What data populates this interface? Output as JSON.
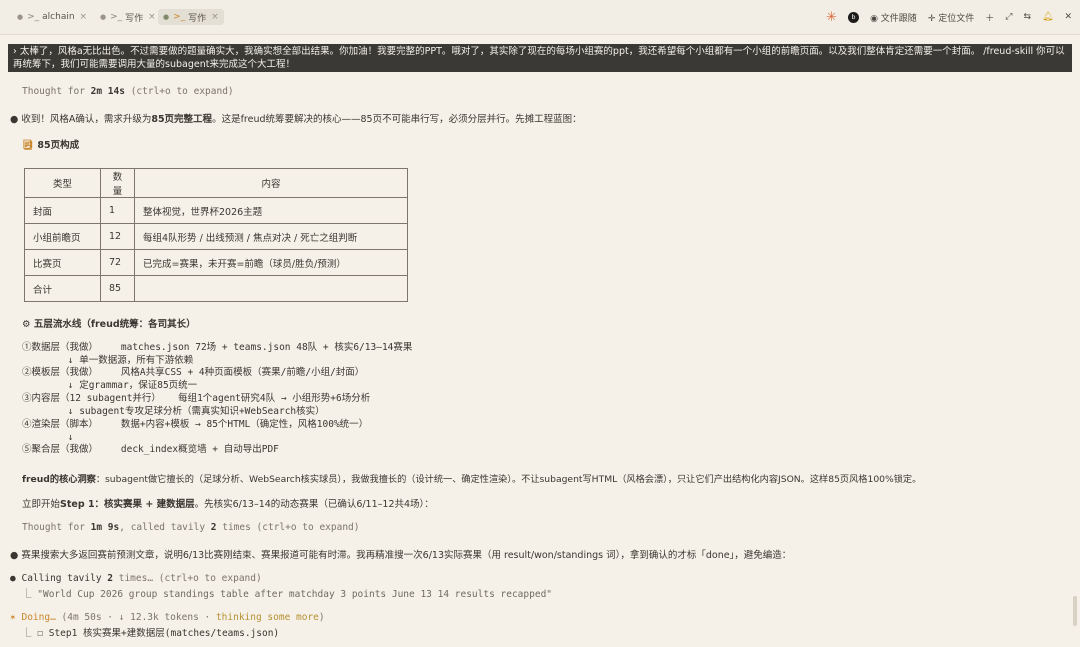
{
  "tabs": [
    {
      "label": "alchain",
      "active": false
    },
    {
      "label": "写作",
      "active": false
    },
    {
      "label": "写作",
      "active": true
    }
  ],
  "toolbar": {
    "file_follow": "文件跟随",
    "locate_file": "定位文件",
    "avatar_text": "b"
  },
  "prompt": {
    "text": "太棒了，风格a无比出色。不过需要做的题量确实大，我确实想全部出结果。你加油！我要完整的PPT。哦对了，其实除了现在的每场小组赛的ppt，我还希望每个小组都有一个小组的前瞻页面。以及我们整体肯定还需要一个封面。 /freud-skill 你可以再统筹下，我们可能需要调用大量的subagent来完成这个大工程！"
  },
  "thought1": {
    "prefix": "Thought for ",
    "time": "2m 14s",
    "suffix": " (ctrl+o to expand)"
  },
  "intro": {
    "a": "收到！风格A确认，需求升级为",
    "b": "85页完整工程",
    "c": "。这是freud统筹要解决的核心——85页不可能串行写，必须分层并行。先摊工程蓝图："
  },
  "section1_title": "85页构成",
  "table": {
    "headers": [
      "类型",
      "数量",
      "内容"
    ],
    "rows": [
      [
        "封面",
        "1",
        "整体视觉，世界杯2026主题"
      ],
      [
        "小组前瞻页",
        "12",
        "每组4队形势 / 出线预测 / 焦点对决 / 死亡之组判断"
      ],
      [
        "比赛页",
        "72",
        "已完成=赛果，未开赛=前瞻（球员/胜负/预测）"
      ],
      [
        "合计",
        "85",
        ""
      ]
    ]
  },
  "section2_title": "五层流水线（freud统筹：各司其长）",
  "pipeline": [
    "①数据层（我做）    matches.json 72场 + teams.json 48队 + 核实6/13–14赛果",
    "        ↓ 单一数据源，所有下游依赖",
    "②模板层（我做）    风格A共享CSS + 4种页面模板（赛果/前瞻/小组/封面）",
    "        ↓ 定grammar，保证85页统一",
    "③内容层（12 subagent并行）   每组1个agent研究4队 → 小组形势+6场分析",
    "        ↓ subagent专攻足球分析（需真实知识+WebSearch核实）",
    "④渲染层（脚本）    数据+内容+模板 → 85个HTML（确定性，风格100%统一）",
    "        ↓",
    "⑤聚合层（我做）    deck_index概览墙 + 自动导出PDF"
  ],
  "insight": {
    "label": "freud的核心洞察",
    "text": "：subagent做它擅长的（足球分析、WebSearch核实球员），我做我擅长的（设计统一、确定性渲染）。不让subagent写HTML（风格会漂），只让它们产出结构化内容JSON。这样85页风格100%锁定。"
  },
  "step": {
    "a": "立即开始",
    "b": "Step 1：核实赛果 + 建数据层",
    "c": "。先核实6/13–14的动态赛果（已确认6/11–12共4场）："
  },
  "thought2": {
    "prefix": "Thought for ",
    "time": "1m 9s",
    "mid": ", called tavily ",
    "count": "2",
    "suffix": " times (ctrl+o to expand)"
  },
  "note": "赛果搜索大多返回赛前预测文章，说明6/13比赛刚结束、赛果报道可能有时滞。我再精准搜一次6/13实际赛果（用 result/won/standings 词），拿到确认的才标「done」，避免编造：",
  "calling": {
    "a": "Calling tavily ",
    "b": "2",
    "c": " times… (ctrl+o to expand)",
    "query": "\"World Cup 2026 group standings table after matchday 3 points June 13 14 results recapped\""
  },
  "doing": {
    "label": "Doing…",
    "meta": " (4m 50s · ↓ 12.3k tokens · ",
    "thinking": "thinking some more",
    "end": ")"
  },
  "todo": "Step1 核实赛果+建数据层(matches/teams.json)"
}
